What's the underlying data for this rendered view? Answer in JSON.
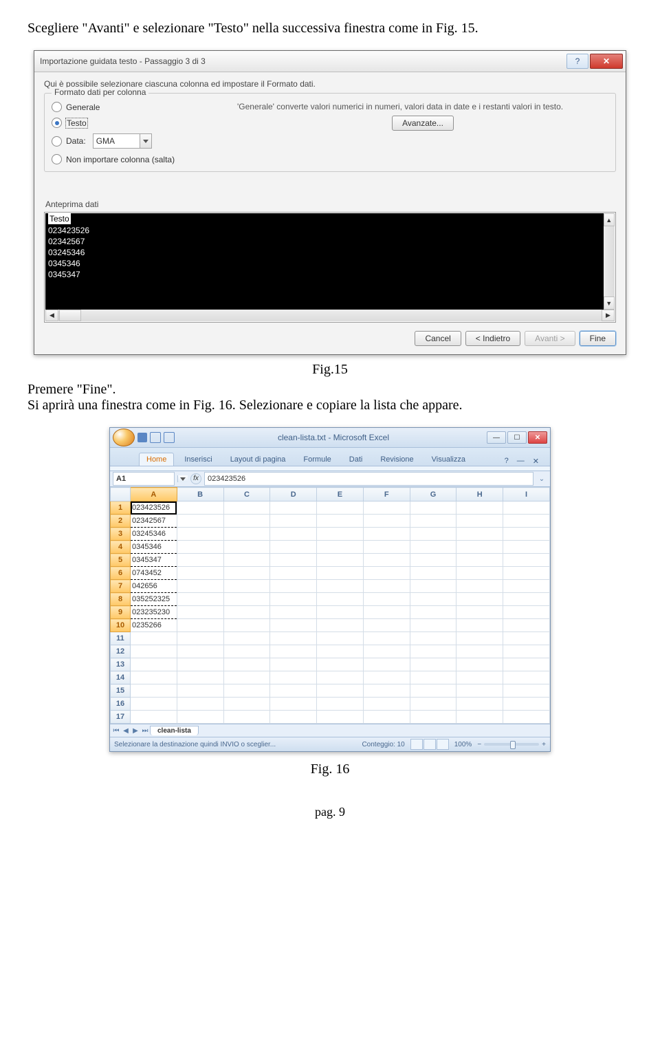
{
  "intro_text": "Scegliere \"Avanti\" e selezionare \"Testo\" nella successiva finestra come in Fig. 15.",
  "fig15_caption": "Fig.15",
  "mid_text_1": "Premere \"Fine\".",
  "mid_text_2": "Si aprirà una finestra come in Fig. 16. Selezionare e copiare la lista che appare.",
  "fig16_caption": "Fig. 16",
  "page_footer": "pag. 9",
  "dialog": {
    "title": "Importazione guidata testo - Passaggio 3 di 3",
    "help_icon": "?",
    "close_icon": "✕",
    "description": "Qui è possibile selezionare ciascuna colonna ed impostare il Formato dati.",
    "group_legend": "Formato dati per colonna",
    "radios": {
      "generale": "Generale",
      "testo": "Testo",
      "data": "Data:",
      "noimport": "Non importare colonna (salta)"
    },
    "data_combo": "GMA",
    "right_desc": "'Generale' converte valori numerici in numeri, valori data in date e i restanti valori in testo.",
    "advanced_btn": "Avanzate...",
    "preview_label": "Anteprima dati",
    "preview_header": "Testo",
    "preview_rows": [
      "023423526",
      "02342567",
      "03245346",
      "0345346",
      "0345347"
    ],
    "btn_cancel": "Cancel",
    "btn_back": "< Indietro",
    "btn_next": "Avanti >",
    "btn_finish": "Fine"
  },
  "excel": {
    "title": "clean-lista.txt - Microsoft Excel",
    "tabs": [
      "Home",
      "Inserisci",
      "Layout di pagina",
      "Formule",
      "Dati",
      "Revisione",
      "Visualizza"
    ],
    "namebox": "A1",
    "fx_label": "fx",
    "formula_value": "023423526",
    "columns": [
      "A",
      "B",
      "C",
      "D",
      "E",
      "F",
      "G",
      "H",
      "I"
    ],
    "data_rows": [
      "023423526",
      "02342567",
      "03245346",
      "0345346",
      "0345347",
      "0743452",
      "042656",
      "035252325",
      "023235230",
      "0235266"
    ],
    "blank_rows": 7,
    "sheet_name": "clean-lista",
    "status_msg": "Selezionare la destinazione quindi INVIO o sceglier...",
    "count_label": "Conteggio: 10",
    "zoom_label": "100%"
  }
}
